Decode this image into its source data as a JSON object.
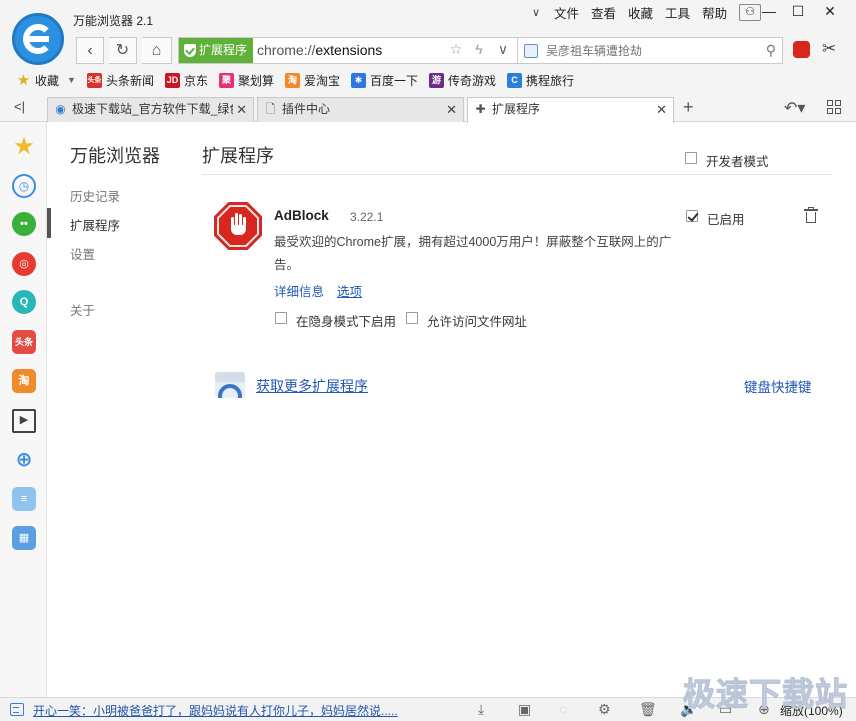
{
  "app": {
    "title": "万能浏览器 2.1",
    "menu": [
      "文件",
      "查看",
      "收藏",
      "工具",
      "帮助"
    ]
  },
  "address": {
    "secure_label": "扩展程序",
    "url_scheme": "chrome://",
    "url_path": "extensions",
    "search_placeholder": "吴彦祖车辆遭抢劫"
  },
  "bookmarks": [
    {
      "label": "收藏",
      "icon": "star-icon"
    },
    {
      "label": "头条新闻",
      "icon": "toutiao-icon",
      "color": "#d8322a",
      "glyph": "头条"
    },
    {
      "label": "京东",
      "icon": "jd-icon",
      "color": "#c81623",
      "glyph": "JD"
    },
    {
      "label": "聚划算",
      "icon": "juhuasuan-icon",
      "color": "#e8307a",
      "glyph": "聚"
    },
    {
      "label": "爱淘宝",
      "icon": "aitaobao-icon",
      "color": "#f5882b",
      "glyph": "淘"
    },
    {
      "label": "百度一下",
      "icon": "baidu-icon",
      "color": "#3075e4",
      "glyph": "✱"
    },
    {
      "label": "传奇游戏",
      "icon": "chuanqi-icon",
      "color": "#6b2f8a",
      "glyph": "游"
    },
    {
      "label": "携程旅行",
      "icon": "ctrip-icon",
      "color": "#2a7fd6",
      "glyph": "C"
    }
  ],
  "tabs": [
    {
      "label": "极速下载站_官方软件下载_绿色",
      "icon": "ie-icon"
    },
    {
      "label": "插件中心",
      "icon": "page-icon"
    },
    {
      "label": "扩展程序",
      "icon": "puzzle-icon",
      "active": true
    }
  ],
  "nav": {
    "title": "万能浏览器",
    "items": [
      "历史记录",
      "扩展程序",
      "设置",
      "关于"
    ]
  },
  "main": {
    "title": "扩展程序",
    "developer_mode": "开发者模式",
    "extension": {
      "name": "AdBlock",
      "version": "3.22.1",
      "description": "最受欢迎的Chrome扩展，拥有超过4000万用户！屏蔽整个互联网上的广告。",
      "details_link": "详细信息",
      "options_link": "选项",
      "incognito_label": "在隐身模式下启用",
      "file_access_label": "允许访问文件网址",
      "enabled_label": "已启用",
      "enabled": true
    },
    "more_extensions": "获取更多扩展程序",
    "keyboard_shortcuts": "键盘快捷键"
  },
  "status": {
    "text": "开心一笑：小明被爸爸打了，跟妈妈说有人打你儿子，妈妈居然说.....",
    "zoom": "缩放(100%)"
  },
  "watermark": "极速下载站",
  "colors": {
    "secure_green": "#5fb13a",
    "adblock_red": "#d7271e",
    "link_blue": "#1f58b5"
  }
}
